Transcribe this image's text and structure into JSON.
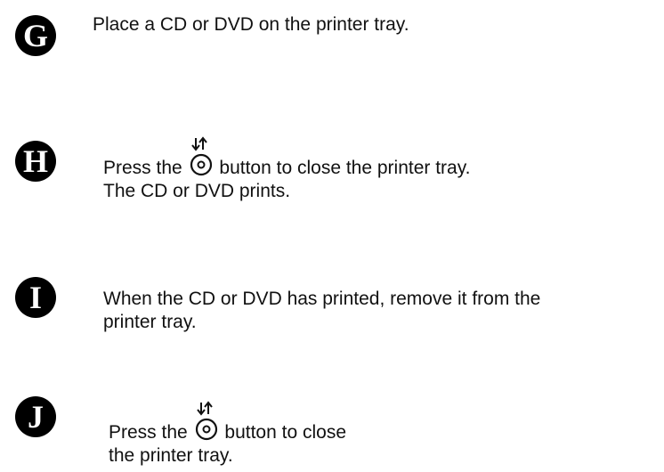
{
  "steps": [
    {
      "letter": "G",
      "lines": [
        "Place a CD or DVD on the printer tray."
      ]
    },
    {
      "letter": "H",
      "line1_before": "Press the",
      "line1_after": "button to close the printer tray.",
      "line2": "The CD or DVD prints.",
      "icon": "disc-eject-close-button-icon"
    },
    {
      "letter": "I",
      "lines": [
        "When the CD or DVD has printed, remove it from the",
        "printer tray."
      ]
    },
    {
      "letter": "J",
      "line1_before": "Press the",
      "line1_after": "button to close",
      "line2": "the printer tray.",
      "icon": "disc-eject-close-button-icon"
    }
  ]
}
